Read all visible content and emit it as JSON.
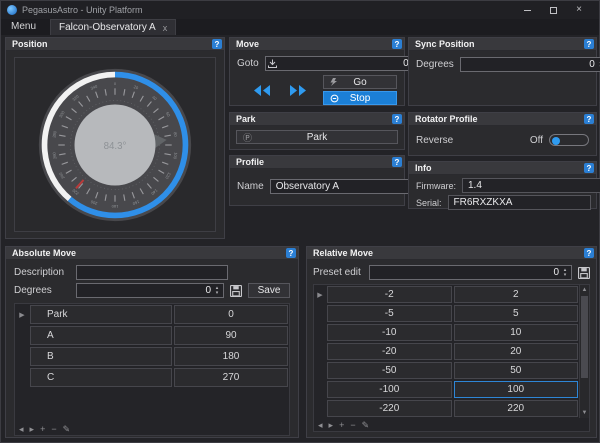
{
  "window": {
    "title": "PegasusAstro - Unity Platform"
  },
  "tabs": {
    "menu_label": "Menu",
    "active_label": "Falcon-Observatory A"
  },
  "position": {
    "title": "Position",
    "dial": {
      "value_label": "84.3°",
      "pointer_degrees": 84.3,
      "blue_arc_start": 0,
      "blue_arc_end": 220,
      "white_arc_start": 220,
      "white_arc_end": 360,
      "red_mark_degrees": 222,
      "tick_step_degrees": 10,
      "number_step_degrees": 20
    }
  },
  "move": {
    "title": "Move",
    "goto_label": "Goto",
    "goto_value": "0",
    "go_label": "Go",
    "stop_label": "Stop"
  },
  "sync": {
    "title": "Sync Position",
    "degrees_label": "Degrees",
    "degrees_value": "0"
  },
  "park": {
    "title": "Park",
    "button_label": "Park"
  },
  "rotator": {
    "title": "Rotator Profile",
    "reverse_label": "Reverse",
    "reverse_value": "Off"
  },
  "profile": {
    "title": "Profile",
    "name_label": "Name",
    "name_value": "Observatory A"
  },
  "info": {
    "title": "Info",
    "firmware_label": "Firmware:",
    "firmware_value": "1.4",
    "serial_label": "Serial:",
    "serial_value": "FR6RXZKXA"
  },
  "absolute": {
    "title": "Absolute Move",
    "description_label": "Description",
    "description_value": "",
    "degrees_label": "Degrees",
    "degrees_value": "0",
    "save_label": "Save",
    "rows": [
      {
        "name": "Park",
        "value": "0"
      },
      {
        "name": "A",
        "value": "90"
      },
      {
        "name": "B",
        "value": "180"
      },
      {
        "name": "C",
        "value": "270"
      }
    ]
  },
  "relative": {
    "title": "Relative Move",
    "preset_label": "Preset edit",
    "preset_value": "0",
    "rows": [
      {
        "neg": "-2",
        "pos": "2"
      },
      {
        "neg": "-5",
        "pos": "5"
      },
      {
        "neg": "-10",
        "pos": "10"
      },
      {
        "neg": "-20",
        "pos": "20"
      },
      {
        "neg": "-50",
        "pos": "50"
      },
      {
        "neg": "-100",
        "pos": "100"
      },
      {
        "neg": "-220",
        "pos": "220"
      }
    ],
    "selected": {
      "row": 5,
      "col": "pos"
    }
  },
  "glyphs": {
    "help": "?",
    "win_close": "×",
    "tab_close": "x",
    "spin_up": "▴",
    "spin_down": "▾",
    "gear": "⚙",
    "park": "Ⓟ",
    "row_indicator": "▶",
    "nav_prev": "◂",
    "nav_next": "▸",
    "nav_add": "+",
    "nav_remove": "−",
    "nav_edit": "✎",
    "scroll_up": "▲",
    "scroll_down": "▼"
  },
  "colors": {
    "accent_blue": "#2f9bf0",
    "stop_button": "#1b7fd6",
    "help_badge": "#2b7fd4",
    "white_arc": "#f2f2f2",
    "blue_arc": "#2f8fe8",
    "red_mark": "#b83a3a",
    "panel_bg": "#2b2b2e",
    "header_bg": "#39393d",
    "selection_border": "#2e86d6"
  }
}
